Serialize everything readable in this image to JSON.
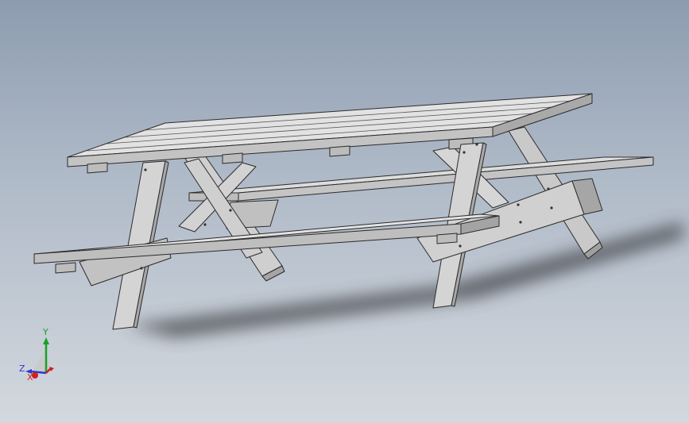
{
  "viewport": {
    "model_name": "picnic-table",
    "background_top": "#8d9cb0",
    "background_bottom": "#d3d8de",
    "part_face_color": "#d9d9d9",
    "part_edge_color": "#2b2b2b"
  },
  "triad": {
    "x_label": "X",
    "y_label": "Y",
    "z_label": "Z",
    "x_color": "#d12020",
    "y_color": "#1aa02a",
    "z_color": "#2a3ad0"
  }
}
